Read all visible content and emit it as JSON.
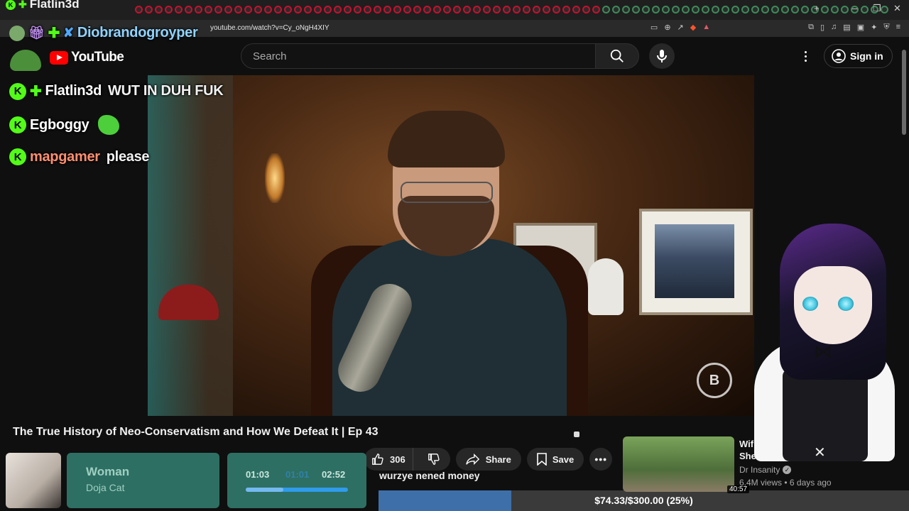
{
  "browser": {
    "url": "youtube.com/watch?v=Cy_oNgH4XIY",
    "tab_top_name": "Flatlin3d"
  },
  "youtube": {
    "logo_text": "YouTube",
    "search_placeholder": "Search",
    "sign_in": "Sign in"
  },
  "overlay_user": {
    "name": "Diobrandogroyper"
  },
  "chat": [
    {
      "user": "Flatlin3d",
      "message": "WUT IN DUH FUK",
      "user_color": "#ffffff"
    },
    {
      "user": "Egboggy",
      "message": "",
      "user_color": "#ffffff"
    },
    {
      "user": "mapgamer",
      "message": "please",
      "user_color": "#ff8f70"
    }
  ],
  "video": {
    "title": "The True History of Neo-Conservatism and How We Defeat It | Ep 43",
    "likes": "306",
    "share_label": "Share",
    "save_label": "Save"
  },
  "now_playing": {
    "title": "Woman",
    "artist": "Doja Cat",
    "current_time": "01:03",
    "mid_time": "01:01",
    "total_time": "02:52",
    "progress": 0.37
  },
  "donation": {
    "message": "wurzye nened money",
    "goal_text": "$74.33/$300.00 (25%)",
    "goal_fraction": 0.25
  },
  "recommended": {
    "title_line1": "Wif",
    "title_line2": "She",
    "channel": "Dr Insanity",
    "meta": "6.4M views • 6 days ago",
    "duration": "40:57"
  },
  "colors": {
    "kick_green": "#53fc18",
    "youtube_red": "#ff0000",
    "widget_teal": "#2e6f63",
    "goal_blue": "#3f6fa8"
  }
}
